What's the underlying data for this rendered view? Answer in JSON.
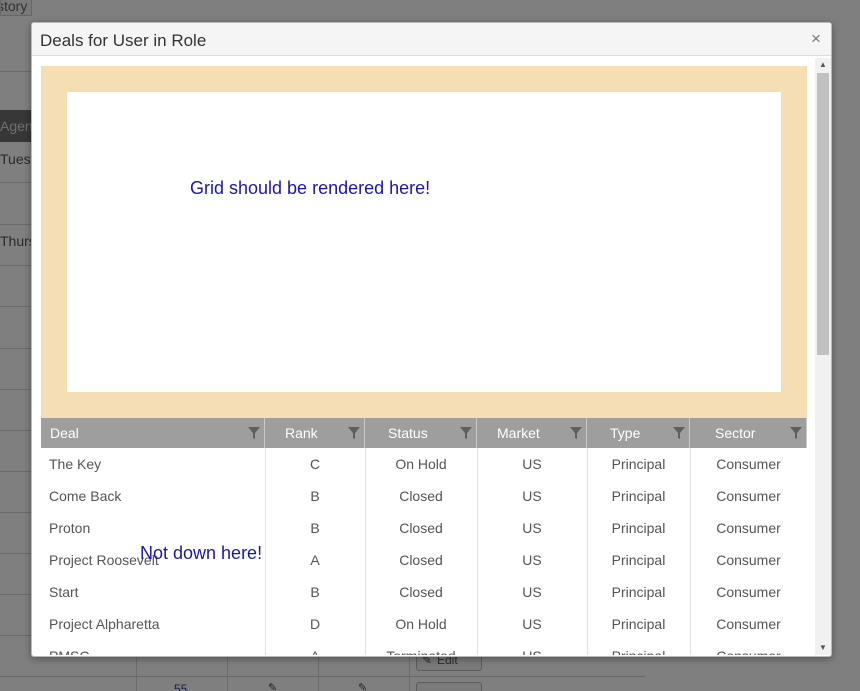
{
  "background": {
    "tab_label": "story",
    "header_label": "Agen",
    "days": [
      "Tuesd",
      "Thurs"
    ],
    "row_number": "55",
    "edit_label": "Edit"
  },
  "dialog": {
    "title": "Deals for User in Role",
    "close_glyph": "×",
    "placeholder_message": "Grid should be rendered here!",
    "misplaced_message": "Not down here!"
  },
  "grid": {
    "columns": [
      "Deal",
      "Rank",
      "Status",
      "Market",
      "Type",
      "Sector"
    ],
    "rows": [
      [
        "The Key",
        "C",
        "On Hold",
        "US",
        "Principal",
        "Consumer"
      ],
      [
        "Come Back",
        "B",
        "Closed",
        "US",
        "Principal",
        "Consumer"
      ],
      [
        "Proton",
        "B",
        "Closed",
        "US",
        "Principal",
        "Consumer"
      ],
      [
        "Project Roosevelt",
        "A",
        "Closed",
        "US",
        "Principal",
        "Consumer"
      ],
      [
        "Start",
        "B",
        "Closed",
        "US",
        "Principal",
        "Consumer"
      ],
      [
        "Project Alpharetta",
        "D",
        "On Hold",
        "US",
        "Principal",
        "Consumer"
      ],
      [
        "PMSC",
        "A",
        "Terminated",
        "US",
        "Principal",
        "Consumer"
      ]
    ]
  },
  "colors": {
    "panel_background": "#f5deb3",
    "message_text": "#1b17a8",
    "grid_header": "#9e9e9e"
  },
  "icons": [
    "close-icon",
    "filter-icon",
    "scroll-up-icon",
    "scroll-down-icon",
    "pencil-icon"
  ]
}
